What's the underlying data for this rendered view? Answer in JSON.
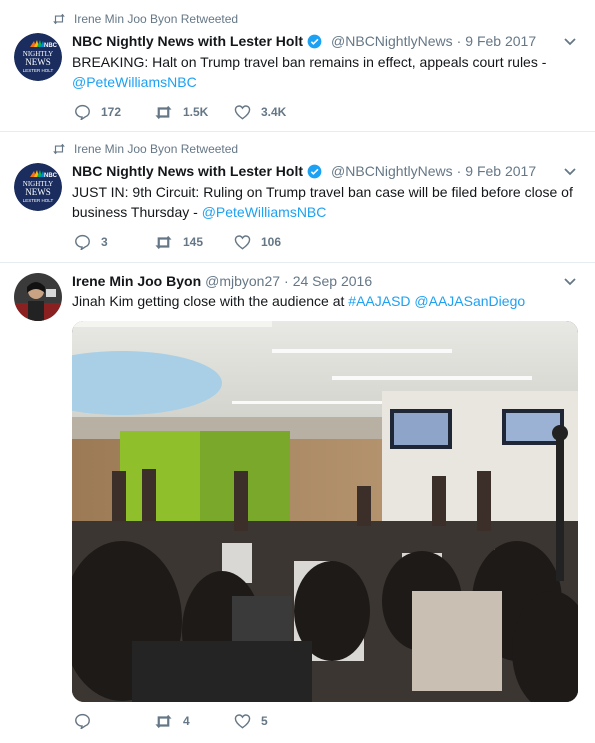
{
  "tweets": [
    {
      "retweeted_by": "Irene Min Joo Byon Retweeted",
      "name": "NBC Nightly News with Lester Holt",
      "handle": "@NBCNightlyNews",
      "date": "9 Feb 2017",
      "text": "BREAKING: Halt on Trump travel ban remains in effect, appeals court rules -",
      "mention": "@PeteWilliamsNBC",
      "avatar_lines": [
        "NBC",
        "NIGHTLY",
        "NEWS",
        "LESTER HOLT"
      ],
      "replies": "172",
      "retweets": "1.5K",
      "likes": "3.4K"
    },
    {
      "retweeted_by": "Irene Min Joo Byon Retweeted",
      "name": "NBC Nightly News with Lester Holt",
      "handle": "@NBCNightlyNews",
      "date": "9 Feb 2017",
      "text_line1": "JUST IN: 9th Circuit: Ruling on Trump travel ban case will be filed before close of",
      "text_line2": "business Thursday -",
      "mention": "@PeteWilliamsNBC",
      "avatar_lines": [
        "NBC",
        "NIGHTLY",
        "NEWS",
        "LESTER HOLT"
      ],
      "replies": "3",
      "retweets": "145",
      "likes": "106"
    },
    {
      "name": "Irene Min Joo Byon",
      "handle": "@mjbyon27",
      "date": "24 Sep 2016",
      "text": "Jinah Kim getting close with the audience at",
      "hashtag": "#AAJASD",
      "mention": "@AAJASanDiego",
      "replies": "",
      "retweets": "4",
      "likes": "5"
    }
  ],
  "colors": {
    "link": "#1da1f2",
    "muted": "#657786",
    "verified": "#1da1f2",
    "nbc_blue": "#1a2d5e"
  },
  "separator": "·"
}
